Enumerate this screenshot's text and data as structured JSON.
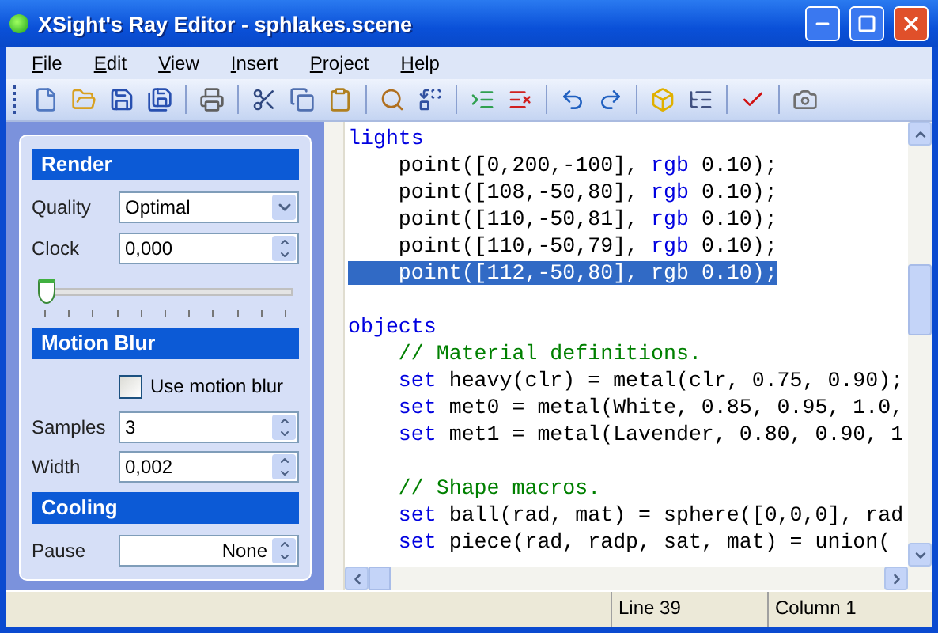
{
  "window": {
    "title": "XSight's Ray Editor - sphlakes.scene"
  },
  "menu": [
    "File",
    "Edit",
    "View",
    "Insert",
    "Project",
    "Help"
  ],
  "panel": {
    "sections": [
      {
        "title": "Render",
        "rows": [
          {
            "kind": "dropdown",
            "label": "Quality",
            "value": "Optimal"
          },
          {
            "kind": "spinner",
            "label": "Clock",
            "value": "0,000"
          },
          {
            "kind": "slider",
            "level": 0
          }
        ]
      },
      {
        "title": "Motion Blur",
        "rows": [
          {
            "kind": "checkbox",
            "label": "Use motion blur",
            "checked": false
          },
          {
            "kind": "spinner",
            "label": "Samples",
            "value": "3"
          },
          {
            "kind": "spinner",
            "label": "Width",
            "value": "0,002"
          }
        ]
      },
      {
        "title": "Cooling",
        "rows": [
          {
            "kind": "choice",
            "label": "Pause",
            "value": "None"
          }
        ]
      }
    ]
  },
  "code": [
    {
      "selected": false,
      "segments": [
        {
          "kind": "keyword",
          "text": "lights"
        }
      ]
    },
    {
      "selected": false,
      "segments": [
        {
          "kind": "plain",
          "text": "    point([0,200,-100], "
        },
        {
          "kind": "keyword",
          "text": "rgb"
        },
        {
          "kind": "plain",
          "text": " 0.10);"
        }
      ]
    },
    {
      "selected": false,
      "segments": [
        {
          "kind": "plain",
          "text": "    point([108,-50,80], "
        },
        {
          "kind": "keyword",
          "text": "rgb"
        },
        {
          "kind": "plain",
          "text": " 0.10);"
        }
      ]
    },
    {
      "selected": false,
      "segments": [
        {
          "kind": "plain",
          "text": "    point([110,-50,81], "
        },
        {
          "kind": "keyword",
          "text": "rgb"
        },
        {
          "kind": "plain",
          "text": " 0.10);"
        }
      ]
    },
    {
      "selected": false,
      "segments": [
        {
          "kind": "plain",
          "text": "    point([110,-50,79], "
        },
        {
          "kind": "keyword",
          "text": "rgb"
        },
        {
          "kind": "plain",
          "text": " 0.10);"
        }
      ]
    },
    {
      "selected": true,
      "segments": [
        {
          "kind": "plain",
          "text": "    point([112,-50,80], "
        },
        {
          "kind": "keyword",
          "text": "rgb"
        },
        {
          "kind": "plain",
          "text": " 0.10);"
        }
      ]
    },
    {
      "selected": false
    },
    {
      "selected": false,
      "segments": [
        {
          "kind": "keyword",
          "text": "objects"
        }
      ]
    },
    {
      "selected": false,
      "segments": [
        {
          "kind": "comment",
          "text": "    // Material definitions."
        }
      ]
    },
    {
      "selected": false,
      "segments": [
        {
          "kind": "keyword",
          "text": "    set"
        },
        {
          "kind": "plain",
          "text": " heavy(clr) = metal(clr, 0.75, 0.90);"
        }
      ]
    },
    {
      "selected": false,
      "segments": [
        {
          "kind": "keyword",
          "text": "    set"
        },
        {
          "kind": "plain",
          "text": " met0 = metal(White, 0.85, 0.95, 1.0,"
        }
      ]
    },
    {
      "selected": false,
      "segments": [
        {
          "kind": "keyword",
          "text": "    set"
        },
        {
          "kind": "plain",
          "text": " met1 = metal(Lavender, 0.80, 0.90, 1"
        }
      ]
    },
    {
      "selected": false
    },
    {
      "selected": false,
      "segments": [
        {
          "kind": "comment",
          "text": "    // Shape macros."
        }
      ]
    },
    {
      "selected": false,
      "segments": [
        {
          "kind": "keyword",
          "text": "    set"
        },
        {
          "kind": "plain",
          "text": " ball(rad, mat) = sphere([0,0,0], rad"
        }
      ]
    },
    {
      "selected": false,
      "segments": [
        {
          "kind": "keyword",
          "text": "    set"
        },
        {
          "kind": "plain",
          "text": " piece(rad, radp, sat, mat) = union("
        }
      ]
    }
  ],
  "status_bar": {
    "line": "Line 39",
    "column": "Column 1"
  }
}
